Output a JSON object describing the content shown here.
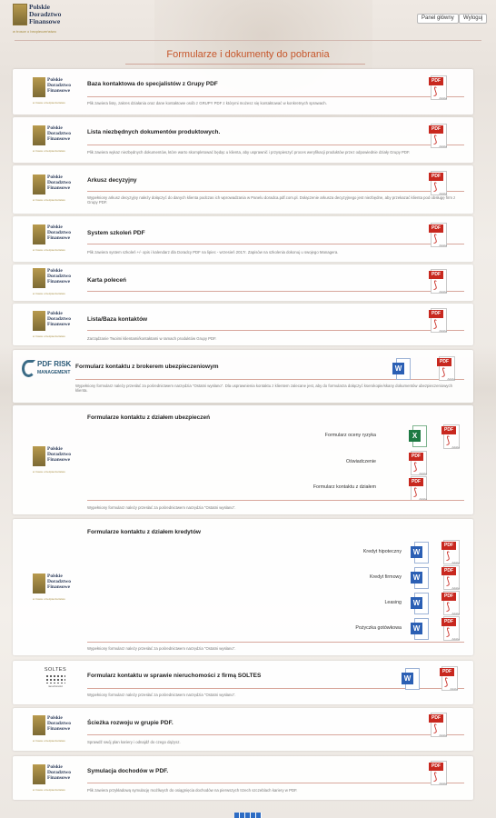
{
  "header": {
    "logo_line1": "Polskie",
    "logo_line2": "Doradztwo",
    "logo_line3": "Finansowe",
    "logo_tagline": "w trosce o bezpieczeństwo",
    "panel_button": "Panel główny",
    "logout_button": "Wyloguj"
  },
  "page_title": "Formularze i dokumenty do pobrania",
  "brand_logo": {
    "l1": "Polskie",
    "l2": "Doradztwo",
    "l3": "Finansowe",
    "tag": "w trosce o bezpieczeństwo"
  },
  "cards": [
    {
      "title": "Baza kontaktowa do specjalistów z Grupy PDF",
      "desc": "Plik zawiera listę, zakres działania oraz dane kontaktowe osób z GRUPY PDF z którymi możesz się kontaktować w konkretnych sprawach."
    },
    {
      "title": "Lista niezbędnych dokumentów produktowych.",
      "desc": "Plik zawiera wykaz niezbędnych dokumentów, które warto skompletować będąc u klienta, aby usprawnić i przyspieszyć proces weryfikacji produktów przez odpowiednie działy Grupy PDF."
    },
    {
      "title": "Arkusz decyzyjny",
      "desc": "Wypełniony arkusz decyzyjny należy dołączyć do danych klienta podczas ich wprowadzania w Panelu doradca.pdf.com.pl. Dołączenie arkusza decyzyjnego jest niezbędne, aby przekazać klienta pod obsługę firm z Grupy PDF."
    },
    {
      "title": "System szkoleń PDF",
      "desc": "Plik zawiera system szkoleń +/- opis i kalendarz dla Doradcy PDF na lipiec - wrzesień 2017r. Zapisów na szkolenia dokonuj u swojego Managera."
    },
    {
      "title": "Karta poleceń",
      "desc": ""
    },
    {
      "title": "Lista/Baza kontaktów",
      "desc": "Zarządzanie Twoimi klientami/kontaktami w ramach produktów Grupy PDF."
    },
    {
      "title": "Formularz kontaktu z brokerem ubezpieczeniowym",
      "desc": "Wypełniony formularz należy przesłać za pośrednictwem narzędzia \"Ostatni wysłano\". Dla usprawnienia kontaktu z klientem zalecane jest, aby do formularza dołączyć kserokopie/skany dokumentów ubezpieczeniowych klienta.",
      "logo_t1": "PDF RISK",
      "logo_t2": "MANAGEMENT"
    },
    {
      "title": "Formularze kontaktu z działem ubezpieczeń",
      "desc": "Wypełniony formularz należy przesłać za pośrednictwem narzędzia \"Ostatni wysłano\".",
      "items": [
        "Formularz oceny ryzyka",
        "Oświadczenie",
        "Formularz kontaktu z działem"
      ]
    },
    {
      "title": "Formularze kontaktu z działem kredytów",
      "desc": "Wypełniony formularz należy przesłać za pośrednictwem narzędzia \"Ostatni wysłano\".",
      "items": [
        "Kredyt hipoteczny",
        "Kredyt firmowy",
        "Leasing",
        "Pożyczka gotówkowa"
      ]
    },
    {
      "title": "Formularz kontaktu w sprawie nieruchomości z firmą SOLTES",
      "desc": "Wypełniony formularz należy przesłać za pośrednictwem narzędzia \"Ostatni wysłano\".",
      "logo_t1": "SOLTES",
      "logo_t2": "nieruchomości"
    },
    {
      "title": "Ścieżka rozwoju w grupie PDF.",
      "desc": "Sprawdź swój plan kariery i odnajdź do czego dążysz."
    },
    {
      "title": "Symulacja dochodów w PDF.",
      "desc": "Plik zawiera przykładową symulację możliwych do osiągnięcia dochodów na pierwszych trzech szczeblach kariery w PDF."
    }
  ],
  "icons": {
    "pdf_label": "PDF",
    "pdf_symbol": "⟆",
    "adobe": "Adobe",
    "word_letter": "W",
    "excel_letter": "X"
  },
  "colors": {
    "accent": "#c6572c",
    "pdf_red": "#c8281f",
    "word_blue": "#2b5fb4",
    "excel_green": "#1e7a43"
  }
}
